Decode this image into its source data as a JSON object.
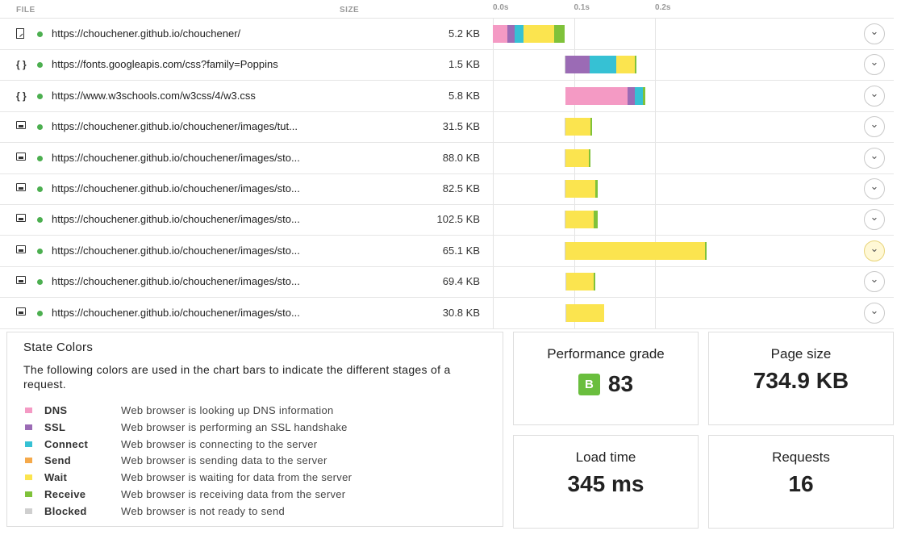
{
  "header": {
    "file_label": "FILE",
    "size_label": "SIZE"
  },
  "timeline": {
    "ticks": [
      {
        "label": "0.0s",
        "seconds": 0.0
      },
      {
        "label": "0.1s",
        "seconds": 0.1
      },
      {
        "label": "0.2s",
        "seconds": 0.2
      }
    ]
  },
  "rows": [
    {
      "icon": "document-icon",
      "url": "https://chouchener.github.io/chouchener/",
      "size": "5.2 KB",
      "timing": [
        [
          "dns",
          0,
          0.018
        ],
        [
          "ssl",
          0.018,
          0.027
        ],
        [
          "connect",
          0.027,
          0.038
        ],
        [
          "wait",
          0.038,
          0.076
        ],
        [
          "receive",
          0.076,
          0.089
        ]
      ]
    },
    {
      "icon": "css-icon",
      "url": "https://fonts.googleapis.com/css?family=Poppins",
      "size": "1.5 KB",
      "timing": [
        [
          "blocked",
          0.089,
          0.09
        ],
        [
          "ssl",
          0.09,
          0.119
        ],
        [
          "connect",
          0.119,
          0.152
        ],
        [
          "wait",
          0.152,
          0.175
        ],
        [
          "receive",
          0.175,
          0.177
        ]
      ]
    },
    {
      "icon": "css-icon",
      "url": "https://www.w3schools.com/w3css/4/w3.css",
      "size": "5.8 KB",
      "timing": [
        [
          "dns",
          0.09,
          0.166
        ],
        [
          "ssl",
          0.166,
          0.175
        ],
        [
          "connect",
          0.175,
          0.185
        ],
        [
          "receive",
          0.185,
          0.188
        ]
      ]
    },
    {
      "icon": "image-icon",
      "url": "https://chouchener.github.io/chouchener/images/tut...",
      "size": "31.5 KB",
      "timing": [
        [
          "blocked",
          0.089,
          0.09
        ],
        [
          "wait",
          0.09,
          0.12
        ],
        [
          "receive",
          0.12,
          0.122
        ]
      ]
    },
    {
      "icon": "image-icon",
      "url": "https://chouchener.github.io/chouchener/images/sto...",
      "size": "88.0 KB",
      "timing": [
        [
          "blocked",
          0.089,
          0.09
        ],
        [
          "wait",
          0.09,
          0.118
        ],
        [
          "receive",
          0.118,
          0.12
        ]
      ]
    },
    {
      "icon": "image-icon",
      "url": "https://chouchener.github.io/chouchener/images/sto...",
      "size": "82.5 KB",
      "timing": [
        [
          "blocked",
          0.089,
          0.09
        ],
        [
          "wait",
          0.09,
          0.126
        ],
        [
          "receive",
          0.126,
          0.129
        ]
      ]
    },
    {
      "icon": "image-icon",
      "url": "https://chouchener.github.io/chouchener/images/sto...",
      "size": "102.5 KB",
      "timing": [
        [
          "blocked",
          0.089,
          0.09
        ],
        [
          "wait",
          0.09,
          0.124
        ],
        [
          "receive",
          0.124,
          0.129
        ]
      ]
    },
    {
      "icon": "image-icon",
      "url": "https://chouchener.github.io/chouchener/images/sto...",
      "size": "65.1 KB",
      "timing": [
        [
          "blocked",
          0.089,
          0.09
        ],
        [
          "wait",
          0.09,
          0.262
        ],
        [
          "receive",
          0.262,
          0.2635
        ]
      ]
    },
    {
      "icon": "image-icon",
      "url": "https://chouchener.github.io/chouchener/images/sto...",
      "size": "69.4 KB",
      "timing": [
        [
          "blocked",
          0.09,
          0.091
        ],
        [
          "wait",
          0.091,
          0.124
        ],
        [
          "receive",
          0.124,
          0.126
        ]
      ]
    },
    {
      "icon": "image-icon",
      "url": "https://chouchener.github.io/chouchener/images/sto...",
      "size": "30.8 KB",
      "timing": [
        [
          "blocked",
          0.09,
          0.091
        ],
        [
          "wait",
          0.091,
          0.137
        ]
      ]
    }
  ],
  "active_row": 7,
  "legend": {
    "title": "State Colors",
    "description": "The following colors are used in the chart bars to indicate the different stages of a request.",
    "items": [
      {
        "key": "dns",
        "name": "DNS",
        "text": "Web browser is looking up DNS information",
        "color": "#f49ac4"
      },
      {
        "key": "ssl",
        "name": "SSL",
        "text": "Web browser is performing an SSL handshake",
        "color": "#9b6bb5"
      },
      {
        "key": "connect",
        "name": "Connect",
        "text": "Web browser is connecting to the server",
        "color": "#36c1d4"
      },
      {
        "key": "send",
        "name": "Send",
        "text": "Web browser is sending data to the server",
        "color": "#f5a94a"
      },
      {
        "key": "wait",
        "name": "Wait",
        "text": "Web browser is waiting for data from the server",
        "color": "#fbe44f"
      },
      {
        "key": "receive",
        "name": "Receive",
        "text": "Web browser is receiving data from the server",
        "color": "#7fc23a"
      },
      {
        "key": "blocked",
        "name": "Blocked",
        "text": "Web browser is not ready to send",
        "color": "#cfcfcf"
      }
    ]
  },
  "stats": {
    "performance": {
      "label": "Performance grade",
      "grade": "B",
      "value": "83",
      "grade_color": "#6abe3e"
    },
    "page_size": {
      "label": "Page size",
      "value": "734.9 KB"
    },
    "load_time": {
      "label": "Load time",
      "value": "345 ms"
    },
    "requests": {
      "label": "Requests",
      "value": "16"
    }
  }
}
